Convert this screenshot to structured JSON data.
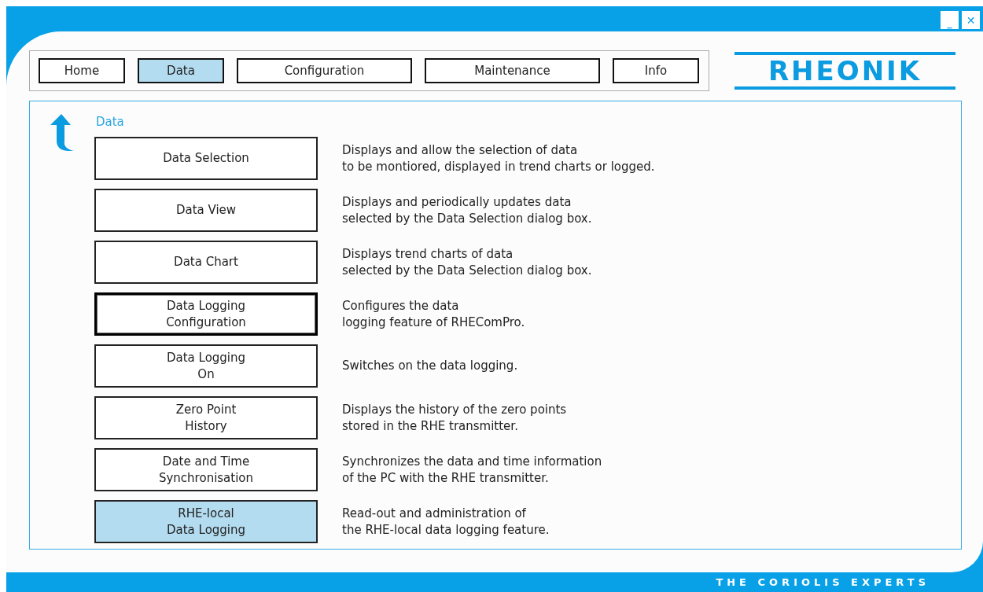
{
  "window_controls": [
    {
      "kind": "minimize",
      "label": "_"
    },
    {
      "kind": "close",
      "label": "✕"
    }
  ],
  "nav": [
    {
      "label": "Home",
      "selected": false
    },
    {
      "label": "Data",
      "selected": true
    },
    {
      "label": "Configuration",
      "selected": false
    },
    {
      "label": "Maintenance",
      "selected": false
    },
    {
      "label": "Info",
      "selected": false
    }
  ],
  "logo": "RHEONIK",
  "section_title": "Data",
  "items": [
    {
      "label": [
        "Data Selection"
      ],
      "description": [
        "Displays and allow the selection of data",
        "to be montiored, displayed in trend charts or logged."
      ],
      "focused": false,
      "selected": false
    },
    {
      "label": [
        "Data View"
      ],
      "description": [
        "Displays and periodically updates data",
        "selected by the Data Selection dialog box."
      ],
      "focused": false,
      "selected": false
    },
    {
      "label": [
        "Data Chart"
      ],
      "description": [
        "Displays trend charts of data",
        "selected by the Data Selection dialog box."
      ],
      "focused": false,
      "selected": false
    },
    {
      "label": [
        "Data Logging",
        "Configuration"
      ],
      "description": [
        "Configures the data",
        "logging feature of RHEComPro."
      ],
      "focused": true,
      "selected": false
    },
    {
      "label": [
        "Data Logging",
        "On"
      ],
      "description": [
        "Switches on the data logging."
      ],
      "focused": false,
      "selected": false
    },
    {
      "label": [
        "Zero Point",
        "History"
      ],
      "description": [
        "Displays the history of the zero points",
        "stored in the RHE transmitter."
      ],
      "focused": false,
      "selected": false
    },
    {
      "label": [
        "Date and Time",
        "Synchronisation"
      ],
      "description": [
        "Synchronizes the data and time information",
        "of the PC with the RHE transmitter."
      ],
      "focused": false,
      "selected": false
    },
    {
      "label": [
        "RHE-local",
        "Data Logging"
      ],
      "description": [
        "Read-out and administration of",
        "the RHE-local data logging feature."
      ],
      "focused": false,
      "selected": true
    }
  ],
  "tagline": "THE CORIOLIS EXPERTS"
}
